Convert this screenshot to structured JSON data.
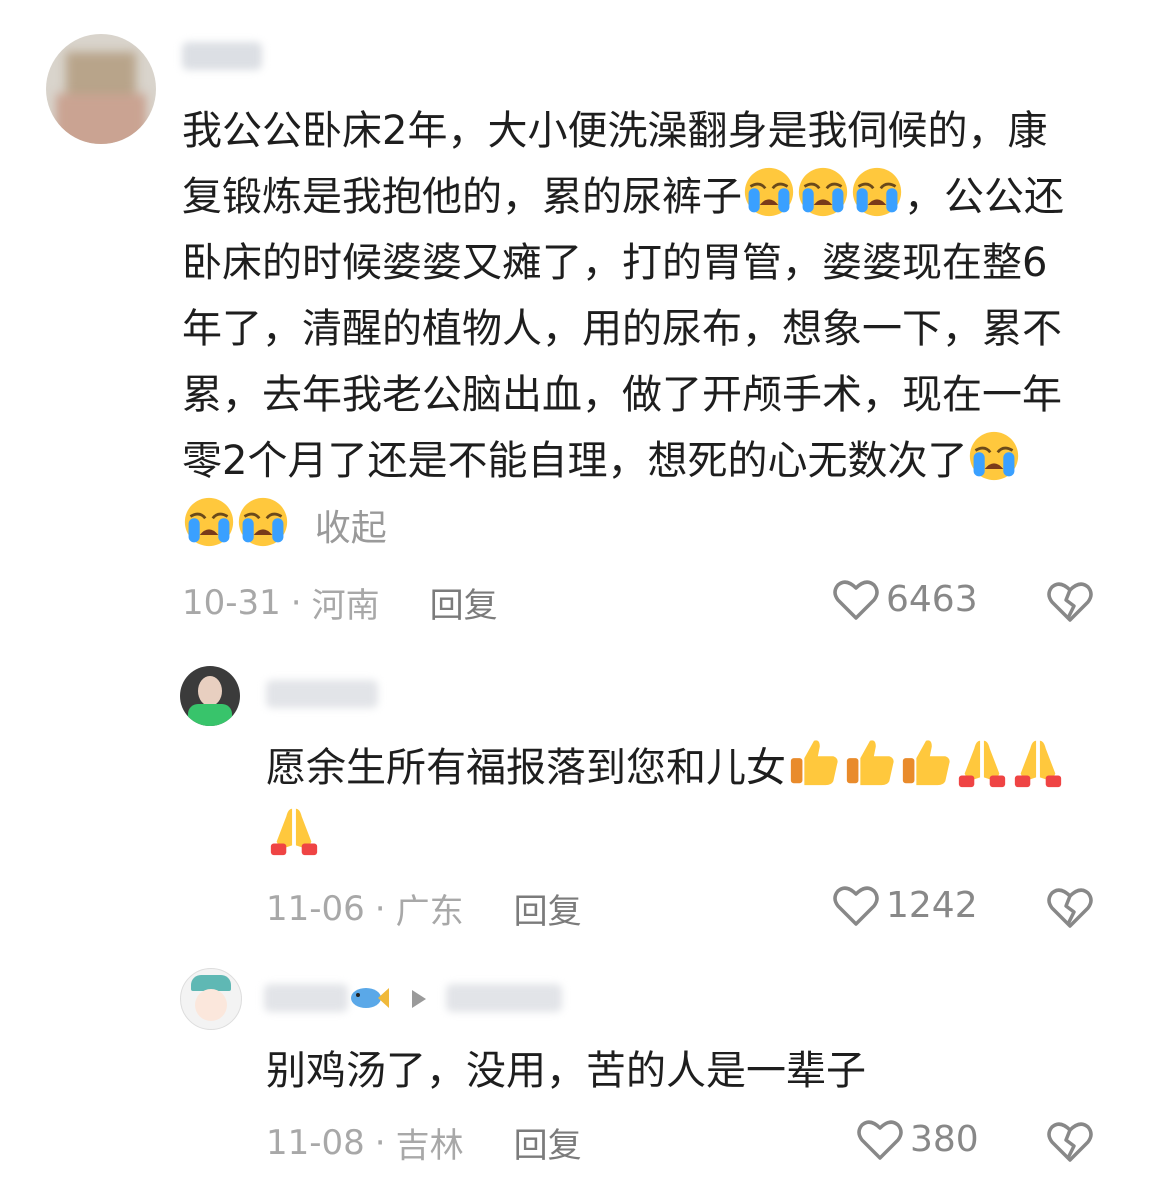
{
  "colors": {
    "text": "#1e1e1e",
    "meta": "#a8a8a8",
    "reply": "#7b7b7b",
    "icon": "#888888",
    "fold": "#9a9a9a"
  },
  "comments": [
    {
      "text_parts": [
        "我公公卧床2年，大小便洗澡翻身是我伺候的，康复锻炼是我抱他的，累的尿裤子",
        "，公公还卧床的时候婆婆又瘫了，打的胃管，婆婆现在整6年了，清醒的植物人，用的尿布，想象一下，累不累，去年我老公脑出血，做了开颅手术，现在一年零2个月了还是不能自理，想死的心无数次了"
      ],
      "fold_label": "收起",
      "date": "10-31",
      "separator": "·",
      "location": "河南",
      "reply_label": "回复",
      "likes": "6463"
    },
    {
      "text": "愿余生所有福报落到您和儿女",
      "date": "11-06",
      "separator": "·",
      "location": "广东",
      "reply_label": "回复",
      "likes": "1242"
    },
    {
      "text": "别鸡汤了，没用，苦的人是一辈子",
      "date": "11-08",
      "separator": "·",
      "location": "吉林",
      "reply_label": "回复",
      "likes": "380"
    }
  ],
  "icons": [
    "crying-face-icon",
    "thumbs-up-icon",
    "praying-hands-icon",
    "heart-outline-icon",
    "broken-heart-icon",
    "fish-icon",
    "reply-arrow-icon"
  ]
}
